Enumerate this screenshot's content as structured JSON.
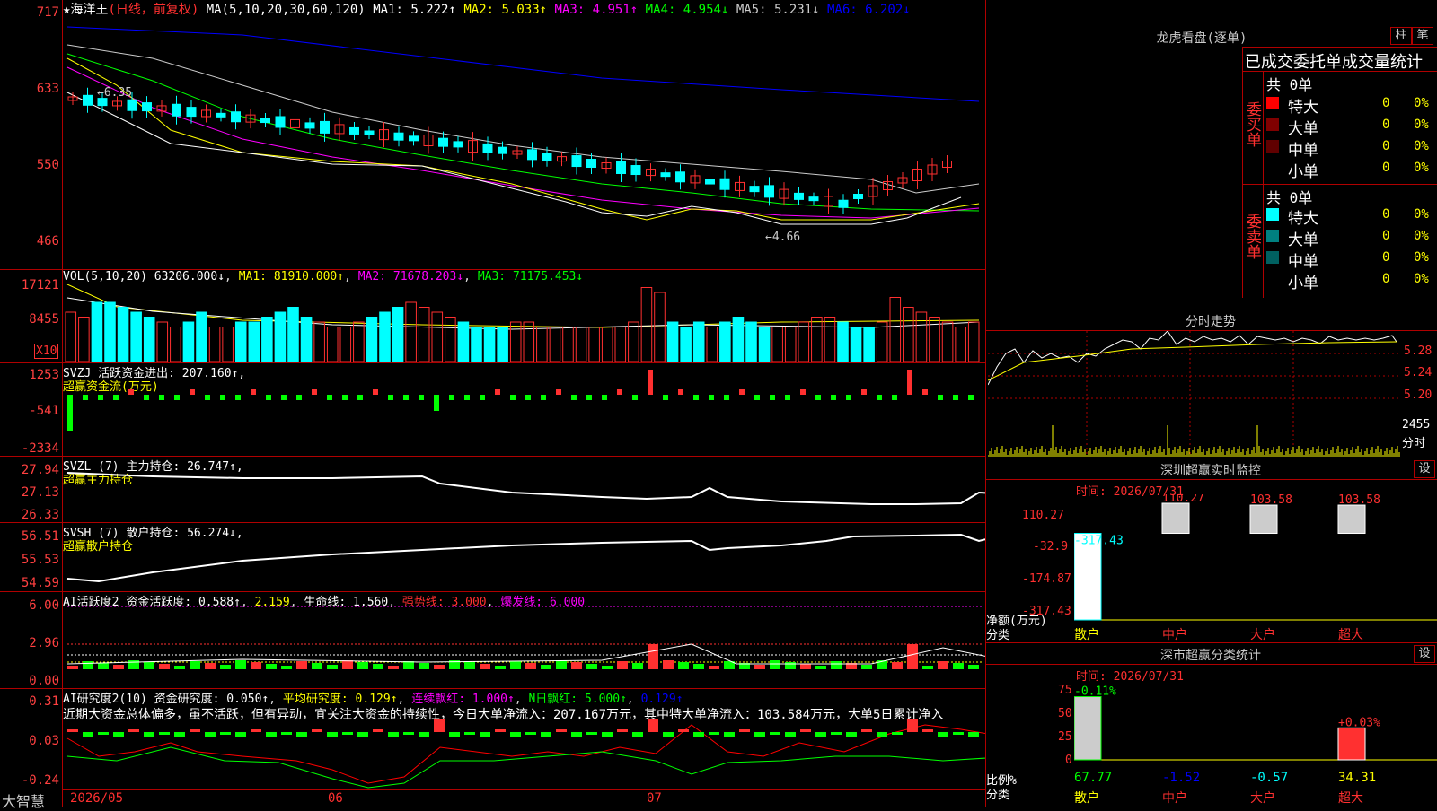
{
  "app": {
    "logo": "大智慧"
  },
  "main_chart": {
    "title": "★海洋王",
    "period": "(日线，前复权)",
    "ma_params": "MA(5,10,20,30,60,120)",
    "ma1": "MA1: 5.222↑",
    "ma2": "MA2: 5.033↑",
    "ma3": "MA3: 4.951↑",
    "ma4": "MA4: 4.954↓",
    "ma5": "MA5: 5.231↓",
    "ma6": "MA6: 6.202↓",
    "y_ticks": [
      "717",
      "633",
      "550",
      "466"
    ],
    "high_label": "←6.35",
    "low_label": "←4.66"
  },
  "vol_panel": {
    "label": "VOL(5,10,20)",
    "value": "63206.000↓",
    "ma1": "MA1: 81910.000↑",
    "ma2": "MA2: 71678.203↓",
    "ma3": "MA3: 71175.453↓",
    "y_ticks": [
      "17121",
      "8455"
    ],
    "unit": "X10",
    "values": [
      10,
      9,
      12,
      12,
      11,
      10,
      9,
      8,
      7,
      8,
      10,
      7,
      7,
      8,
      8,
      9,
      10,
      11,
      9,
      8,
      7,
      7,
      8,
      9,
      10,
      11,
      12,
      11,
      10,
      9,
      8,
      7,
      7,
      7,
      8,
      8,
      7,
      7,
      7,
      7,
      7,
      7,
      7,
      8,
      15,
      14,
      8,
      7,
      8,
      7,
      8,
      9,
      8,
      7,
      7,
      7,
      8,
      9,
      9,
      8,
      7,
      7,
      8,
      13,
      11,
      10,
      9,
      8,
      7,
      8
    ],
    "colors": [
      "r",
      "r",
      "c",
      "c",
      "c",
      "c",
      "c",
      "r",
      "r",
      "c",
      "c",
      "r",
      "r",
      "c",
      "c",
      "c",
      "c",
      "c",
      "c",
      "r",
      "r",
      "r",
      "r",
      "c",
      "c",
      "c",
      "r",
      "r",
      "r",
      "r",
      "c",
      "c",
      "c",
      "c",
      "r",
      "r",
      "r",
      "r",
      "r",
      "r",
      "r",
      "r",
      "r",
      "r",
      "r",
      "r",
      "c",
      "c",
      "c",
      "r",
      "c",
      "c",
      "c",
      "c",
      "r",
      "r",
      "r",
      "r",
      "r",
      "c",
      "c",
      "c",
      "r",
      "r",
      "r",
      "r",
      "r",
      "r",
      "r",
      "r"
    ]
  },
  "svzj_panel": {
    "label": "SVZJ",
    "sub": "活跃资金进出: 207.160↑,",
    "title2": "超赢资金流(万元)",
    "y_ticks": [
      "1253",
      "-541",
      "-2334"
    ]
  },
  "svzl_panel": {
    "label": "SVZL (7)",
    "sub": "主力持仓: 26.747↑,",
    "title2": "超赢主力持仓",
    "y_ticks": [
      "27.94",
      "27.13",
      "26.33"
    ]
  },
  "svsh_panel": {
    "label": "SVSH (7)",
    "sub": "散户持仓: 56.274↓,",
    "title2": "超赢散户持仓",
    "y_ticks": [
      "56.51",
      "55.53",
      "54.59"
    ]
  },
  "ai_active_panel": {
    "label": "AI活跃度2",
    "fund_active": "资金活跃度: 0.588↑",
    "val2": "2.159",
    "life_line": "生命线: 1.560",
    "strong_line": "强势线: 3.000",
    "burst_line": "爆发线: 6.000",
    "y_ticks": [
      "6.00",
      "2.96",
      "0.00"
    ]
  },
  "ai_research_panel": {
    "label": "AI研究度2(10)",
    "fund_research": "资金研究度: 0.050↑",
    "avg_research": "平均研究度: 0.129↑",
    "consec_red": "连续飘红: 1.000↑",
    "n_red": "N日飘红: 5.000↑",
    "val5": "0.129↑",
    "commentary": "近期大资金总体偏多，虽不活跃，但有异动，宜关注大资金的持续性，今日大单净流入：207.167万元，其中特大单净流入：103.584万元，大单5日累计净入",
    "y_ticks": [
      "0.31",
      "0.03",
      "-0.24"
    ]
  },
  "x_axis": {
    "labels": [
      "2026/05",
      "06",
      "07"
    ]
  },
  "right_panel": {
    "longhu": {
      "title": "龙虎看盘(逐单)",
      "btn_bar": "柱",
      "btn_note": "笔",
      "stat_title": "已成交委托单成交量统计",
      "buy_label": "委买单",
      "sell_label": "委卖单",
      "buy_total": "共 0单",
      "sell_total": "共 0单",
      "buy_rows": [
        {
          "name": "特大",
          "count": "0",
          "pct": "0%",
          "color": "#ff0000"
        },
        {
          "name": "大单",
          "count": "0",
          "pct": "0%",
          "color": "#800000"
        },
        {
          "name": "中单",
          "count": "0",
          "pct": "0%",
          "color": "#600000"
        },
        {
          "name": "小单",
          "count": "0",
          "pct": "0%",
          "color": "#000000"
        }
      ],
      "sell_rows": [
        {
          "name": "特大",
          "count": "0",
          "pct": "0%",
          "color": "#00ffff"
        },
        {
          "name": "大单",
          "count": "0",
          "pct": "0%",
          "color": "#008080"
        },
        {
          "name": "中单",
          "count": "0",
          "pct": "0%",
          "color": "#006060"
        },
        {
          "name": "小单",
          "count": "0",
          "pct": "0%",
          "color": "#000000"
        }
      ]
    },
    "intraday": {
      "title": "分时走势",
      "y_ticks": [
        "5.28",
        "5.24",
        "5.20"
      ],
      "vol_tick": "2455",
      "vol_label": "分时"
    },
    "sz_monitor": {
      "title": "深圳超赢实时监控",
      "btn": "设",
      "time": "时间: 2026/07/31",
      "y_ticks": [
        "110.27",
        "-32.9",
        "-174.87",
        "-317.43"
      ],
      "net_label": "净额(万元)",
      "class_label": "分类",
      "categories": [
        "散户",
        "中户",
        "大户",
        "超大"
      ],
      "values": [
        -317.43,
        110.27,
        103.58,
        103.58
      ],
      "value_labels": [
        "-317.43",
        "110.27",
        "103.58",
        "103.58"
      ]
    },
    "sz_class": {
      "title": "深市超赢分类统计",
      "btn": "设",
      "time": "时间: 2026/07/31",
      "y_ticks": [
        "75",
        "50",
        "25",
        "0"
      ],
      "ratio_label": "比例%",
      "class_label": "分类",
      "categories": [
        "散户",
        "中户",
        "大户",
        "超大"
      ],
      "top_labels": [
        "-0.11%",
        "",
        "",
        "+0.03%"
      ],
      "bottom_values": [
        "67.77",
        "-1.52",
        "-0.57",
        "34.31"
      ],
      "values": [
        67.77,
        0,
        0,
        34.31
      ]
    }
  }
}
